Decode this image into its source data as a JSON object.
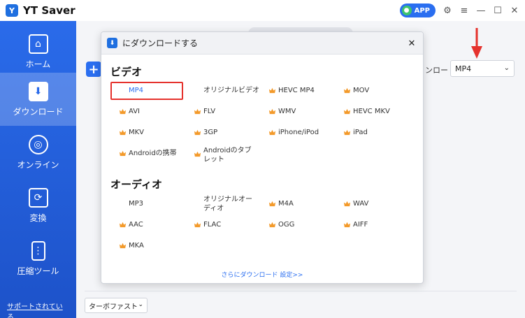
{
  "app": {
    "title": "YT Saver",
    "logo_glyph": "Y",
    "app_badge": "APP"
  },
  "titlebar_icons": [
    "settings-icon",
    "menu-icon",
    "minimize-icon",
    "maximize-icon",
    "close-icon"
  ],
  "sidebar": {
    "items": [
      {
        "label": "ホーム",
        "icon": "home-icon",
        "active": false
      },
      {
        "label": "ダウンロード",
        "icon": "download-icon",
        "active": true
      },
      {
        "label": "オンライン",
        "icon": "online-icon",
        "active": false
      },
      {
        "label": "変換",
        "icon": "convert-icon",
        "active": false
      },
      {
        "label": "圧縮ツール",
        "icon": "compress-icon",
        "active": false
      }
    ],
    "support_link": "サポートされている..."
  },
  "main": {
    "download_format_label": "ンロード",
    "download_format_value": "MP4",
    "speed_value": "ターボファスト"
  },
  "modal": {
    "title": "にダウンロードする",
    "video_section": "ビデオ",
    "audio_section": "オーディオ",
    "video_formats": [
      [
        "MP4",
        "オリジナルビデオ",
        "HEVC MP4",
        "MOV"
      ],
      [
        "AVI",
        "FLV",
        "WMV",
        "HEVC MKV"
      ],
      [
        "MKV",
        "3GP",
        "iPhone/iPod",
        "iPad"
      ],
      [
        "Androidの携帯",
        "Androidのタブ",
        "レット"
      ]
    ],
    "audio_formats": [
      [
        "MP3",
        "オリジナルオー",
        "ディオ",
        "M4A",
        "WAV"
      ],
      [
        "AAC",
        "FLAC",
        "OGG",
        "AIFF"
      ],
      [
        "MKA"
      ]
    ],
    "selected_format": "MP4",
    "more_settings_link": "さらにダウンロード 設定>>"
  },
  "colors": {
    "accent": "#2a6ef0",
    "sidebar": "#1d52c9",
    "crown": "#f39a2b",
    "highlight": "#e5322d"
  }
}
